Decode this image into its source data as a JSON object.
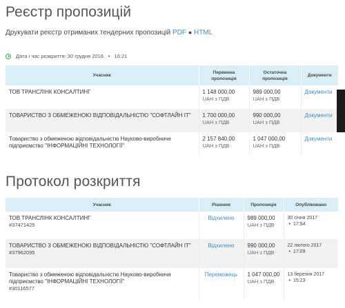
{
  "registry": {
    "title": "Реєстр пропозицій",
    "print_label": "Друкувати реєстр отриманих тендерних пропозицій",
    "pdf_label": "PDF",
    "separator": "●",
    "html_label": "HTML",
    "opening_label": "Дата і час розкриття: 30 грудня 2016",
    "opening_time": "16:21",
    "headers": [
      "Учасник",
      "Первинна пропозиція",
      "Остаточна пропозиція",
      "Документи"
    ],
    "rows": [
      {
        "participant": "ТОВ ТРАНСЛІНК КОНСАЛТИНГ",
        "initial": "1 148 000,00",
        "final": "989 000,00",
        "vat": "UAH з ПДВ",
        "docs": "Документи"
      },
      {
        "participant": "ТОВАРИСТВО З ОБМЕЖЕНОЮ ВІДПОВІДАЛЬНІСТЮ \"СОФТЛАЙН ІТ\"",
        "initial": "1 700 000,00",
        "final": "990 000,00",
        "vat": "UAH з ПДВ",
        "docs": "Документи"
      },
      {
        "participant": "Товариство з обмеженою відповідальністю Науково-виробниче підприємство \"ІНФОРМАЦІЙНІ ТЕХНОЛОГІЇ\"",
        "initial": "2 157 840,00",
        "final": "1 047 000,00",
        "vat": "UAH з ПДВ",
        "docs": "Документи"
      }
    ]
  },
  "protocol": {
    "title": "Протокол розкриття",
    "headers": [
      "Учасник",
      "Рішення",
      "Пропозиція",
      "Опубліковано"
    ],
    "rows": [
      {
        "participant": "ТОВ ТРАНСЛІНК КОНСАЛТИНГ",
        "code": "#37471425",
        "decision": "Відхилено",
        "price": "989 000,00",
        "vat": "UAH з ПДВ",
        "date": "30 січня 2017",
        "time": "17:54"
      },
      {
        "participant": "ТОВАРИСТВО З ОБМЕЖЕНОЮ ВІДПОВІДАЛЬНІСТЮ \"СОФТЛАЙН ІТ\"",
        "code": "#37962095",
        "decision": "Відхилено",
        "price": "990 000,00",
        "vat": "UAH з ПДВ",
        "date": "22 лютого 2017",
        "time": "17:09"
      },
      {
        "participant": "Товариство з обмеженою відповідальністю Науково-виробниче підприємство \"ІНФОРМАЦІЙНІ ТЕХНОЛОГІЇ\"",
        "code": "#30116577",
        "decision": "Переможець",
        "price": "1 047 000,00",
        "vat": "UAH з ПДВ",
        "date": "13 березня 2017",
        "time": "15:23"
      }
    ]
  }
}
